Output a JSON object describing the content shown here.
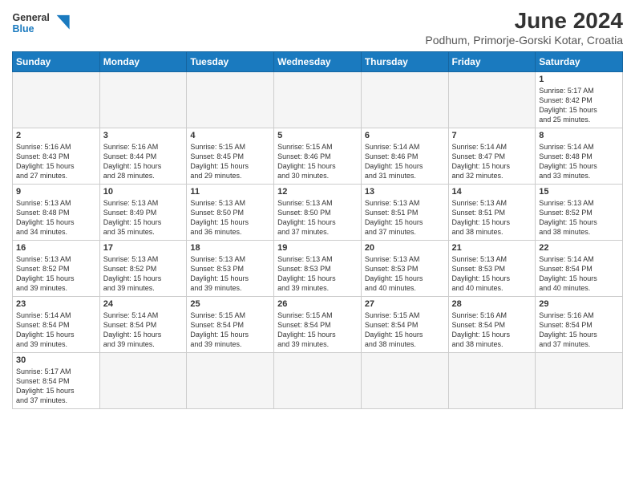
{
  "header": {
    "logo_general": "General",
    "logo_blue": "Blue",
    "month_year": "June 2024",
    "location": "Podhum, Primorje-Gorski Kotar, Croatia"
  },
  "weekdays": [
    "Sunday",
    "Monday",
    "Tuesday",
    "Wednesday",
    "Thursday",
    "Friday",
    "Saturday"
  ],
  "weeks": [
    [
      {
        "day": "",
        "info": ""
      },
      {
        "day": "",
        "info": ""
      },
      {
        "day": "",
        "info": ""
      },
      {
        "day": "",
        "info": ""
      },
      {
        "day": "",
        "info": ""
      },
      {
        "day": "",
        "info": ""
      },
      {
        "day": "1",
        "info": "Sunrise: 5:17 AM\nSunset: 8:42 PM\nDaylight: 15 hours\nand 25 minutes."
      }
    ],
    [
      {
        "day": "2",
        "info": "Sunrise: 5:16 AM\nSunset: 8:43 PM\nDaylight: 15 hours\nand 27 minutes."
      },
      {
        "day": "3",
        "info": "Sunrise: 5:16 AM\nSunset: 8:44 PM\nDaylight: 15 hours\nand 28 minutes."
      },
      {
        "day": "4",
        "info": "Sunrise: 5:15 AM\nSunset: 8:45 PM\nDaylight: 15 hours\nand 29 minutes."
      },
      {
        "day": "5",
        "info": "Sunrise: 5:15 AM\nSunset: 8:46 PM\nDaylight: 15 hours\nand 30 minutes."
      },
      {
        "day": "6",
        "info": "Sunrise: 5:14 AM\nSunset: 8:46 PM\nDaylight: 15 hours\nand 31 minutes."
      },
      {
        "day": "7",
        "info": "Sunrise: 5:14 AM\nSunset: 8:47 PM\nDaylight: 15 hours\nand 32 minutes."
      },
      {
        "day": "8",
        "info": "Sunrise: 5:14 AM\nSunset: 8:48 PM\nDaylight: 15 hours\nand 33 minutes."
      }
    ],
    [
      {
        "day": "9",
        "info": "Sunrise: 5:13 AM\nSunset: 8:48 PM\nDaylight: 15 hours\nand 34 minutes."
      },
      {
        "day": "10",
        "info": "Sunrise: 5:13 AM\nSunset: 8:49 PM\nDaylight: 15 hours\nand 35 minutes."
      },
      {
        "day": "11",
        "info": "Sunrise: 5:13 AM\nSunset: 8:50 PM\nDaylight: 15 hours\nand 36 minutes."
      },
      {
        "day": "12",
        "info": "Sunrise: 5:13 AM\nSunset: 8:50 PM\nDaylight: 15 hours\nand 37 minutes."
      },
      {
        "day": "13",
        "info": "Sunrise: 5:13 AM\nSunset: 8:51 PM\nDaylight: 15 hours\nand 37 minutes."
      },
      {
        "day": "14",
        "info": "Sunrise: 5:13 AM\nSunset: 8:51 PM\nDaylight: 15 hours\nand 38 minutes."
      },
      {
        "day": "15",
        "info": "Sunrise: 5:13 AM\nSunset: 8:52 PM\nDaylight: 15 hours\nand 38 minutes."
      }
    ],
    [
      {
        "day": "16",
        "info": "Sunrise: 5:13 AM\nSunset: 8:52 PM\nDaylight: 15 hours\nand 39 minutes."
      },
      {
        "day": "17",
        "info": "Sunrise: 5:13 AM\nSunset: 8:52 PM\nDaylight: 15 hours\nand 39 minutes."
      },
      {
        "day": "18",
        "info": "Sunrise: 5:13 AM\nSunset: 8:53 PM\nDaylight: 15 hours\nand 39 minutes."
      },
      {
        "day": "19",
        "info": "Sunrise: 5:13 AM\nSunset: 8:53 PM\nDaylight: 15 hours\nand 39 minutes."
      },
      {
        "day": "20",
        "info": "Sunrise: 5:13 AM\nSunset: 8:53 PM\nDaylight: 15 hours\nand 40 minutes."
      },
      {
        "day": "21",
        "info": "Sunrise: 5:13 AM\nSunset: 8:53 PM\nDaylight: 15 hours\nand 40 minutes."
      },
      {
        "day": "22",
        "info": "Sunrise: 5:14 AM\nSunset: 8:54 PM\nDaylight: 15 hours\nand 40 minutes."
      }
    ],
    [
      {
        "day": "23",
        "info": "Sunrise: 5:14 AM\nSunset: 8:54 PM\nDaylight: 15 hours\nand 39 minutes."
      },
      {
        "day": "24",
        "info": "Sunrise: 5:14 AM\nSunset: 8:54 PM\nDaylight: 15 hours\nand 39 minutes."
      },
      {
        "day": "25",
        "info": "Sunrise: 5:15 AM\nSunset: 8:54 PM\nDaylight: 15 hours\nand 39 minutes."
      },
      {
        "day": "26",
        "info": "Sunrise: 5:15 AM\nSunset: 8:54 PM\nDaylight: 15 hours\nand 39 minutes."
      },
      {
        "day": "27",
        "info": "Sunrise: 5:15 AM\nSunset: 8:54 PM\nDaylight: 15 hours\nand 38 minutes."
      },
      {
        "day": "28",
        "info": "Sunrise: 5:16 AM\nSunset: 8:54 PM\nDaylight: 15 hours\nand 38 minutes."
      },
      {
        "day": "29",
        "info": "Sunrise: 5:16 AM\nSunset: 8:54 PM\nDaylight: 15 hours\nand 37 minutes."
      }
    ],
    [
      {
        "day": "30",
        "info": "Sunrise: 5:17 AM\nSunset: 8:54 PM\nDaylight: 15 hours\nand 37 minutes."
      },
      {
        "day": "",
        "info": ""
      },
      {
        "day": "",
        "info": ""
      },
      {
        "day": "",
        "info": ""
      },
      {
        "day": "",
        "info": ""
      },
      {
        "day": "",
        "info": ""
      },
      {
        "day": "",
        "info": ""
      }
    ]
  ]
}
